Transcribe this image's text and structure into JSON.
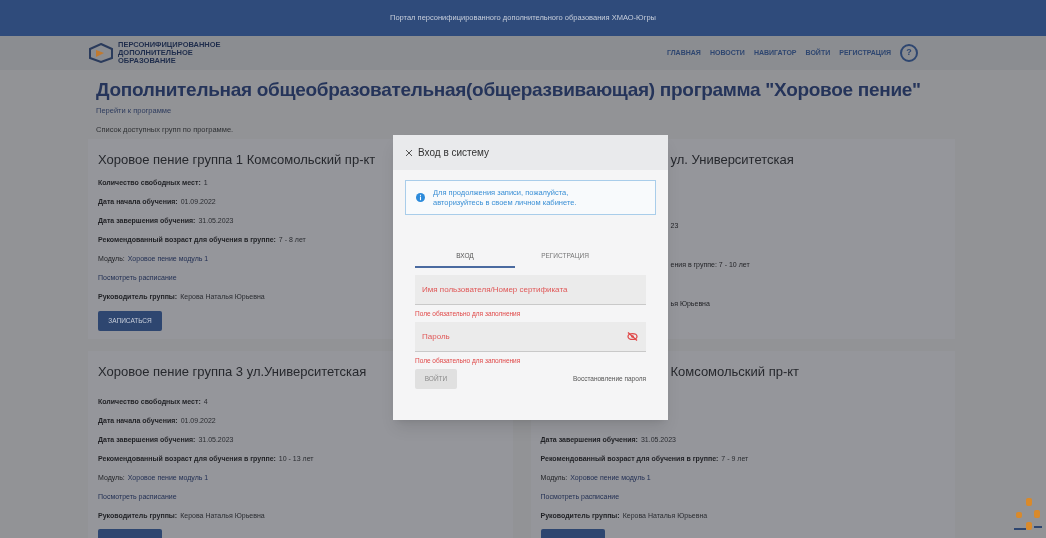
{
  "top_bar": {
    "title": "Портал персонифицированного дополнительного образования ХМАО-Югры"
  },
  "logo": {
    "lines": [
      "ПЕРСОНИФИЦИРОВАННОЕ",
      "ДОПОЛНИТЕЛЬНОЕ",
      "ОБРАЗОВАНИЕ"
    ]
  },
  "nav": {
    "items": [
      "ГЛАВНАЯ",
      "НОВОСТИ",
      "НАВИГАТОР",
      "ВОЙТИ",
      "РЕГИСТРАЦИЯ"
    ],
    "help": "?"
  },
  "page": {
    "title": "Дополнительная общеобразовательная(общеразвивающая) программа \"Хоровое пение\"",
    "back_link": "Перейти к программе",
    "list_caption": "Список доступных групп по программе."
  },
  "groups": [
    {
      "title": "Хоровое пение группа 1 Комсомольский пр-кт",
      "button": "ЗАПИСАТЬСЯ",
      "rows": [
        {
          "kind": "field",
          "label": "Количество свободных мест:",
          "value": "1"
        },
        {
          "kind": "field",
          "label": "Дата начала обучения:",
          "value": "01.09.2022"
        },
        {
          "kind": "field",
          "label": "Дата завершения обучения:",
          "value": "31.05.2023"
        },
        {
          "kind": "field",
          "label": "Рекомендованный возраст для обучения в группе:",
          "value": "7 - 8 лет"
        },
        {
          "kind": "module",
          "label": "Модуль:",
          "value": "Хоровое пение модуль 1"
        },
        {
          "kind": "link",
          "value": "Посмотреть расписание"
        },
        {
          "kind": "field",
          "label": "Руководитель группы:",
          "value": "Керова Наталья Юрьевна"
        }
      ]
    },
    {
      "title": "ул. Университетская",
      "rows": [
        {
          "kind": "fragment",
          "value": "23"
        },
        {
          "kind": "fragment",
          "value": "ения в группе: 7 - 10 лет"
        },
        {
          "kind": "fragment",
          "value": "ья Юрьевна"
        }
      ]
    },
    {
      "title": "Хоровое пение группа 3 ул.Университетская",
      "rows": [
        {
          "kind": "field",
          "label": "Количество свободных мест:",
          "value": "4"
        },
        {
          "kind": "field",
          "label": "Дата начала обучения:",
          "value": "01.09.2022"
        },
        {
          "kind": "field",
          "label": "Дата завершения обучения:",
          "value": "31.05.2023"
        },
        {
          "kind": "field",
          "label": "Рекомендованный возраст для обучения в группе:",
          "value": "10 - 13 лет"
        },
        {
          "kind": "module",
          "label": "Модуль:",
          "value": "Хоровое пение модуль 1"
        },
        {
          "kind": "link",
          "value": "Посмотреть расписание"
        },
        {
          "kind": "field",
          "label": "Руководитель группы:",
          "value": "Керова Наталья Юрьевна"
        }
      ]
    },
    {
      "title": "Комсомольский пр-кт",
      "rows": [
        {
          "kind": "field",
          "label": "Дата завершения обучения:",
          "value": "31.05.2023"
        },
        {
          "kind": "field",
          "label": "Рекомендованный возраст для обучения в группе:",
          "value": "7 - 9 лет"
        },
        {
          "kind": "module",
          "label": "Модуль:",
          "value": "Хоровое пение модуль 1"
        },
        {
          "kind": "link",
          "value": "Посмотреть расписание"
        },
        {
          "kind": "field",
          "label": "Руководитель группы:",
          "value": "Керова Наталья Юрьевна"
        }
      ]
    }
  ],
  "dialog": {
    "title": "Вход в систему",
    "info": "Для продолжения записи, пожалуйста, авторизуйтесь в своем личном кабинете.",
    "tabs": [
      {
        "label": "ВХОД",
        "selected": true
      },
      {
        "label": "РЕГИСТРАЦИЯ",
        "selected": false
      }
    ],
    "fields": [
      {
        "kind": "text",
        "placeholder": "Имя пользователя/Номер сертификата",
        "error": "Поле обязательно для заполнения"
      },
      {
        "kind": "password",
        "placeholder": "Пароль",
        "error": "Поле обязательно для заполнения"
      }
    ],
    "submit": {
      "label": "ВОЙТИ",
      "disabled": true
    },
    "recover_link": "Восстановление пароля"
  }
}
